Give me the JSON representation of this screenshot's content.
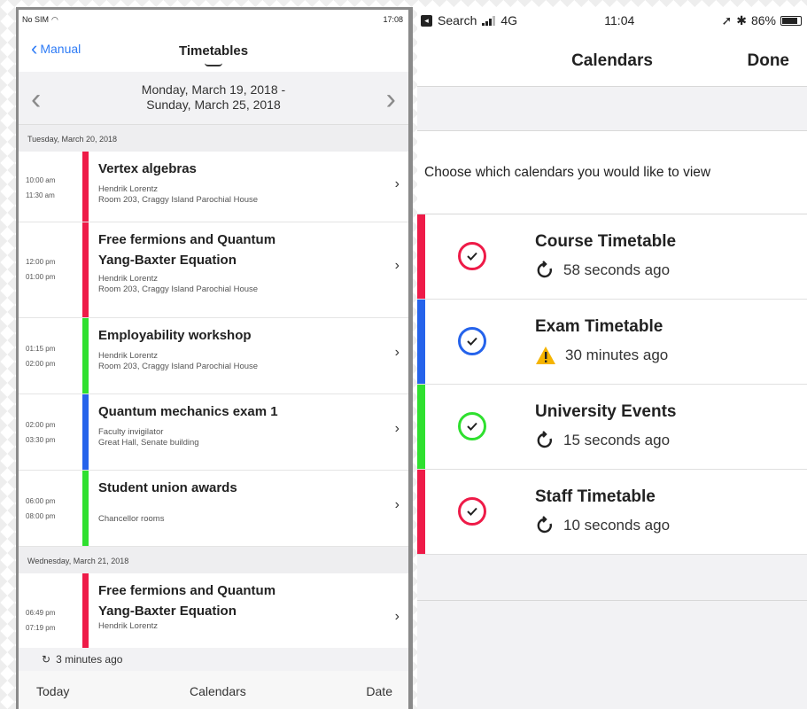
{
  "left": {
    "status": {
      "carrier": "No SIM",
      "time": "17:08"
    },
    "nav": {
      "back_label": "Manual",
      "title": "Timetables"
    },
    "week": {
      "line1": "Monday, March 19, 2018 -",
      "line2": "Sunday, March 25, 2018"
    },
    "day1_header": "Tuesday, March 20, 2018",
    "events_day1": [
      {
        "start": "10:00 am",
        "end": "11:30 am",
        "title1": "Vertex algebras",
        "title2": "",
        "person": "Hendrik Lorentz",
        "place": "Room 203, Craggy Island Parochial House",
        "color": "#ee1b48"
      },
      {
        "start": "12:00 pm",
        "end": "01:00 pm",
        "title1": "Free fermions and Quantum",
        "title2": "Yang-Baxter Equation",
        "person": "Hendrik Lorentz",
        "place": "Room 203, Craggy Island Parochial House",
        "color": "#ee1b48"
      },
      {
        "start": "01:15 pm",
        "end": "02:00 pm",
        "title1": "Employability workshop",
        "title2": "",
        "person": "Hendrik Lorentz",
        "place": "Room 203, Craggy Island Parochial House",
        "color": "#2fe02f"
      },
      {
        "start": "02:00 pm",
        "end": "03:30 pm",
        "title1": "Quantum mechanics exam 1",
        "title2": "",
        "person": "Faculty invigilator",
        "place": "Great Hall, Senate building",
        "color": "#2563eb"
      },
      {
        "start": "06:00 pm",
        "end": "08:00 pm",
        "title1": "Student union awards",
        "title2": "",
        "person": "",
        "place": "Chancellor rooms",
        "color": "#2fe02f"
      }
    ],
    "day2_header": "Wednesday, March 21, 2018",
    "events_day2": [
      {
        "start": "06:49 pm",
        "end": "07:19 pm",
        "title1": "Free fermions and Quantum",
        "title2": "Yang-Baxter Equation",
        "person": "Hendrik Lorentz",
        "place": "",
        "color": "#ee1b48"
      }
    ],
    "sync_text": "3 minutes ago",
    "tabs": {
      "today": "Today",
      "calendars": "Calendars",
      "date": "Date"
    }
  },
  "right": {
    "status": {
      "back_app": "Search",
      "network": "4G",
      "time": "11:04",
      "battery": "86%"
    },
    "nav": {
      "title": "Calendars",
      "done": "Done"
    },
    "instruction": "Choose which calendars you would like to view",
    "calendars": [
      {
        "name": "Course Timetable",
        "updated": "58 seconds ago",
        "color": "#ee1b48",
        "status_icon": "refresh-icon"
      },
      {
        "name": "Exam Timetable",
        "updated": "30 minutes ago",
        "color": "#2563eb",
        "status_icon": "warning-icon"
      },
      {
        "name": "University Events",
        "updated": "15 seconds ago",
        "color": "#2fe02f",
        "status_icon": "refresh-icon"
      },
      {
        "name": "Staff Timetable",
        "updated": "10 seconds ago",
        "color": "#ee1b48",
        "status_icon": "refresh-icon"
      }
    ]
  }
}
